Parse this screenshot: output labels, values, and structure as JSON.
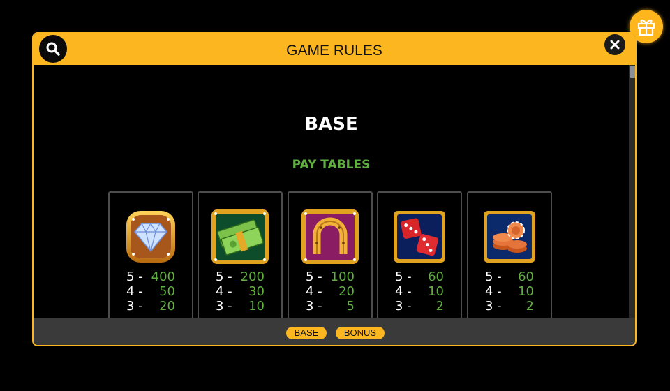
{
  "header": {
    "title": "GAME RULES"
  },
  "icons": {
    "gift": "gift-icon",
    "search": "search-icon",
    "close": "close-icon"
  },
  "section": {
    "title": "BASE",
    "subtitle": "PAY TABLES"
  },
  "paytable": [
    {
      "symbol": "diamond-icon",
      "pays": [
        {
          "count": "5 -",
          "value": "400"
        },
        {
          "count": "4 -",
          "value": "50"
        },
        {
          "count": "3 -",
          "value": "20"
        }
      ]
    },
    {
      "symbol": "cash-stack-icon",
      "pays": [
        {
          "count": "5 -",
          "value": "200"
        },
        {
          "count": "4 -",
          "value": "30"
        },
        {
          "count": "3 -",
          "value": "10"
        }
      ]
    },
    {
      "symbol": "horseshoe-icon",
      "pays": [
        {
          "count": "5 -",
          "value": "100"
        },
        {
          "count": "4 -",
          "value": "20"
        },
        {
          "count": "3 -",
          "value": "5"
        }
      ]
    },
    {
      "symbol": "dice-icon",
      "pays": [
        {
          "count": "5 -",
          "value": "60"
        },
        {
          "count": "4 -",
          "value": "10"
        },
        {
          "count": "3 -",
          "value": "2"
        }
      ]
    },
    {
      "symbol": "casino-chips-icon",
      "pays": [
        {
          "count": "5 -",
          "value": "60"
        },
        {
          "count": "4 -",
          "value": "10"
        },
        {
          "count": "3 -",
          "value": "2"
        }
      ]
    }
  ],
  "footer": {
    "tabs": [
      {
        "label": "BASE"
      },
      {
        "label": "BONUS"
      }
    ]
  },
  "colors": {
    "accent": "#fcb620",
    "pay_value": "#5fae3f",
    "background": "#000000",
    "footer": "#3a3a3a"
  }
}
